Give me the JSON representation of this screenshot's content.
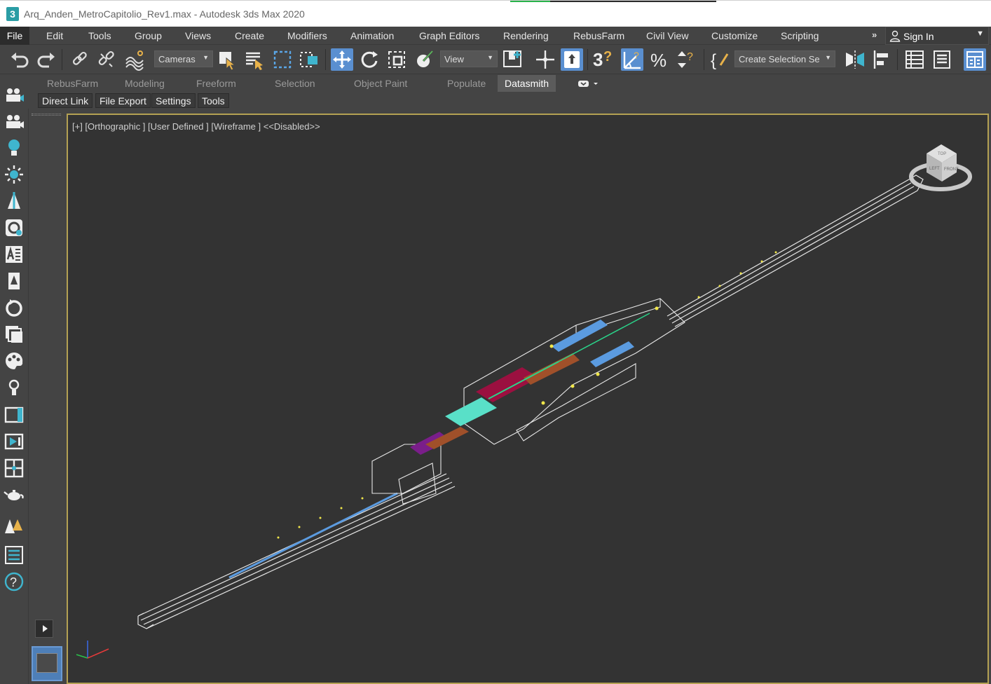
{
  "window": {
    "title": "Arq_Anden_MetroCapitolio_Rev1.max - Autodesk 3ds Max 2020",
    "app_icon_glyph": "3"
  },
  "menu": {
    "items": [
      "File",
      "Edit",
      "Tools",
      "Group",
      "Views",
      "Create",
      "Modifiers",
      "Animation",
      "Graph Editors",
      "Rendering",
      "RebusFarm",
      "Civil View",
      "Customize",
      "Scripting"
    ],
    "overflow": "»",
    "sign_in": "Sign In"
  },
  "toolbar": {
    "cameras": "Cameras",
    "view": "View",
    "create_selection": "Create Selection Se",
    "snaps_label": "3",
    "accent_color": "#5a8fd0"
  },
  "ribbon": {
    "tabs": [
      "RebusFarm",
      "Modeling",
      "Freeform",
      "Selection",
      "Object Paint",
      "Populate",
      "Datasmith"
    ],
    "active_tab": "Datasmith",
    "subtabs": [
      "Direct Link",
      "File Export",
      "Settings",
      "Tools"
    ]
  },
  "viewport": {
    "label": "[+] [Orthographic ] [User Defined ] [Wireframe ]  <<Disabled>>",
    "border_color": "#b4a153",
    "viewcube_faces": [
      "TOP",
      "LEFT",
      "FRONT"
    ]
  },
  "left_panel": {
    "icons": [
      "camera-group-icon",
      "camera-icon",
      "light-bulb-icon",
      "sun-icon",
      "tree-icon",
      "atom-icon",
      "material-browser-icon",
      "tree-list-icon",
      "rotate-icon",
      "layers-icon",
      "palette-icon",
      "light-icon",
      "window-icon",
      "render-frame-icon",
      "viewport-layout-icon",
      "teapot-icon",
      "populate-icon",
      "list-icon",
      "help-icon"
    ]
  }
}
